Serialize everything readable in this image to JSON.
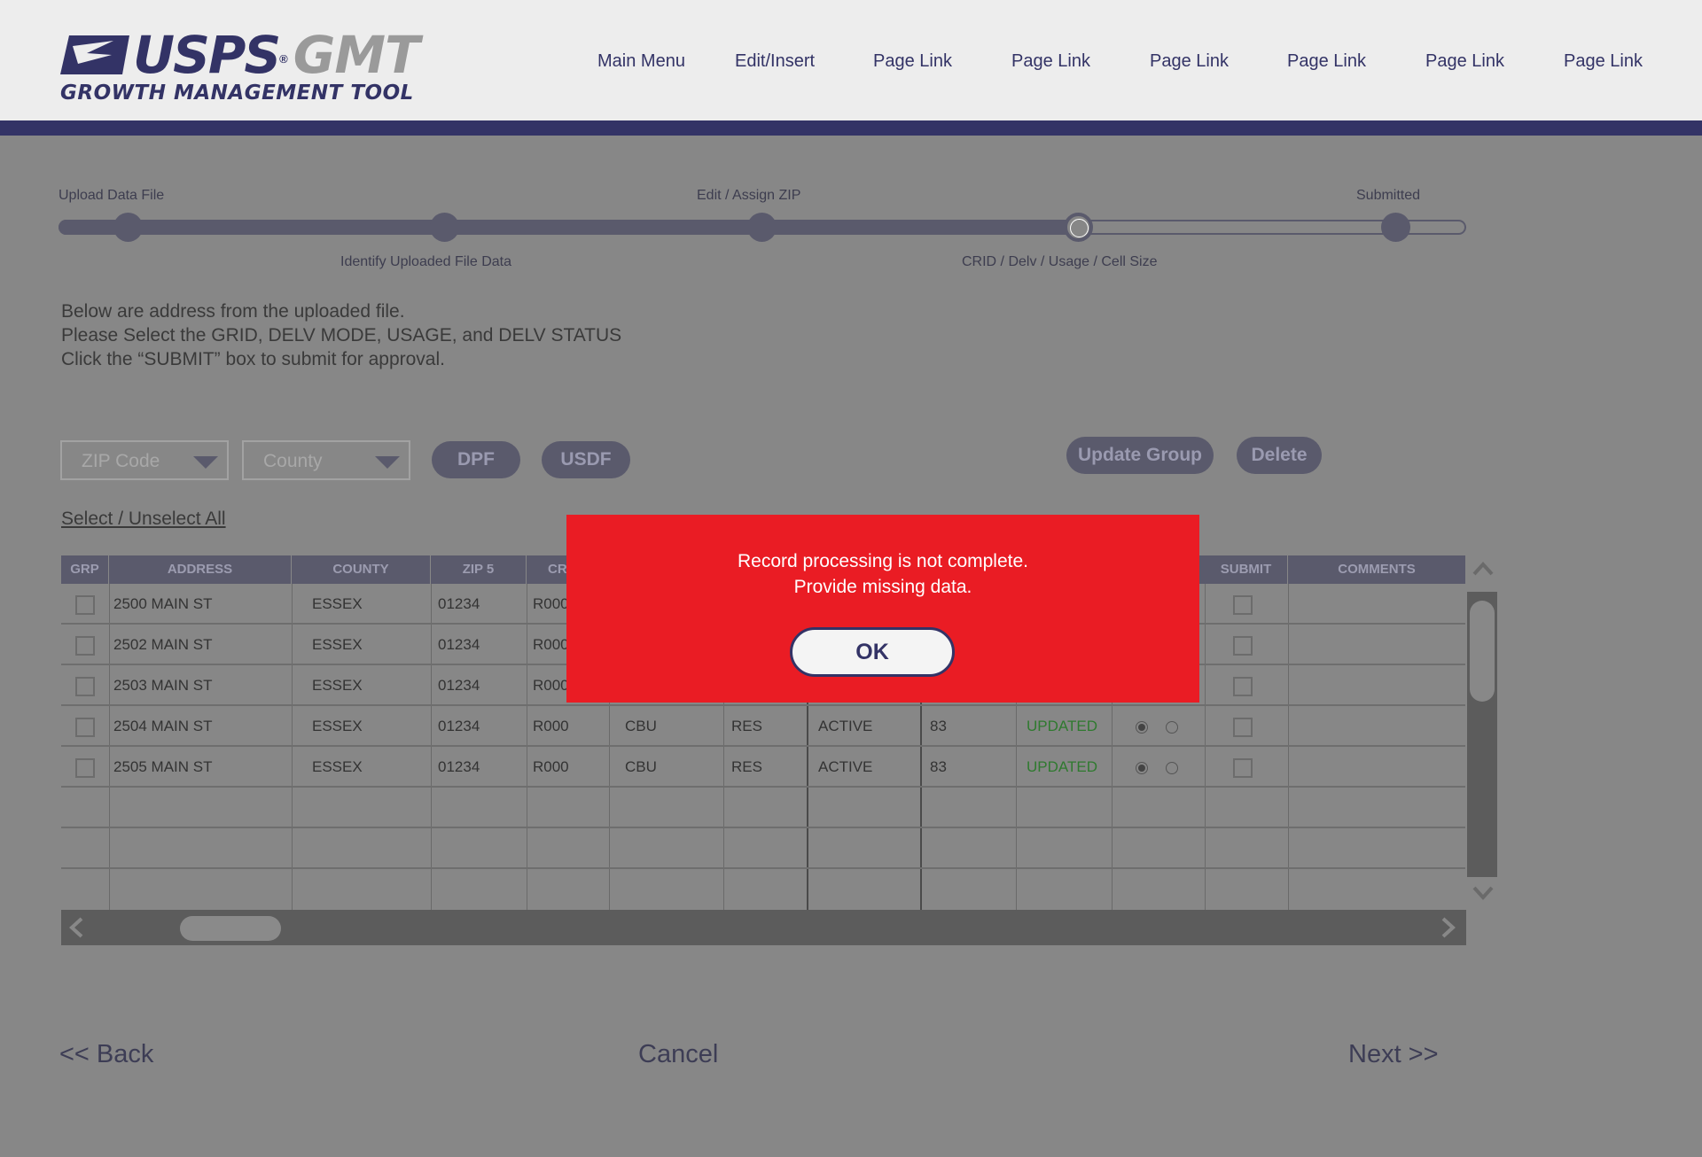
{
  "header": {
    "logo": {
      "brand": "USPS",
      "product": "GMT",
      "reg": "®",
      "subtitle": "GROWTH MANAGEMENT TOOL"
    },
    "nav": [
      "Main Menu",
      "Edit/Insert",
      "Page Link",
      "Page Link",
      "Page Link",
      "Page Link",
      "Page Link",
      "Page Link"
    ]
  },
  "progress": {
    "top_labels": [
      "Upload Data File",
      "Edit / Assign ZIP",
      "Submitted"
    ],
    "bottom_labels": [
      "Identify Uploaded File Data",
      "CRID / Delv / Usage / Cell Size"
    ],
    "current_step": 4,
    "total_steps": 5
  },
  "instructions": [
    "Below are address from the uploaded file.",
    "Please Select the GRID, DELV MODE, USAGE, and DELV STATUS",
    "Click the “SUBMIT” box to submit for approval."
  ],
  "filters": {
    "zip_placeholder": "ZIP Code",
    "county_placeholder": "County",
    "dpf": "DPF",
    "usdf": "USDF",
    "update_group": "Update Group",
    "delete": "Delete"
  },
  "select_all": "Select / Unselect All",
  "table": {
    "headers": [
      "GRP",
      "ADDRESS",
      "COUNTY",
      "ZIP 5",
      "CR",
      "SUBMIT",
      "COMMENTS"
    ],
    "rows": [
      {
        "address": "2500 MAIN ST",
        "county": "ESSEX",
        "zip": "01234",
        "crid": "R000",
        "mode": "",
        "usage": "",
        "status": "",
        "cell": "",
        "state": ""
      },
      {
        "address": "2502 MAIN ST",
        "county": "ESSEX",
        "zip": "01234",
        "crid": "R000",
        "mode": "",
        "usage": "",
        "status": "",
        "cell": "",
        "state": ""
      },
      {
        "address": "2503 MAIN ST",
        "county": "ESSEX",
        "zip": "01234",
        "crid": "R000",
        "mode": "",
        "usage": "",
        "status": "",
        "cell": "",
        "state": ""
      },
      {
        "address": "2504 MAIN ST",
        "county": "ESSEX",
        "zip": "01234",
        "crid": "R000",
        "mode": "CBU",
        "usage": "RES",
        "status": "ACTIVE",
        "cell": "83",
        "state": "UPDATED"
      },
      {
        "address": "2505 MAIN ST",
        "county": "ESSEX",
        "zip": "01234",
        "crid": "R000",
        "mode": "CBU",
        "usage": "RES",
        "status": "ACTIVE",
        "cell": "83",
        "state": "UPDATED"
      }
    ]
  },
  "footer": {
    "back": "<< Back",
    "cancel": "Cancel",
    "next": "Next >>"
  },
  "modal": {
    "line1": "Record processing is not complete.",
    "line2": "Provide missing data.",
    "ok": "OK"
  },
  "colors": {
    "brand_navy": "#333366",
    "alert_red": "#ea1c24",
    "updated_green": "#2f7a2f"
  }
}
